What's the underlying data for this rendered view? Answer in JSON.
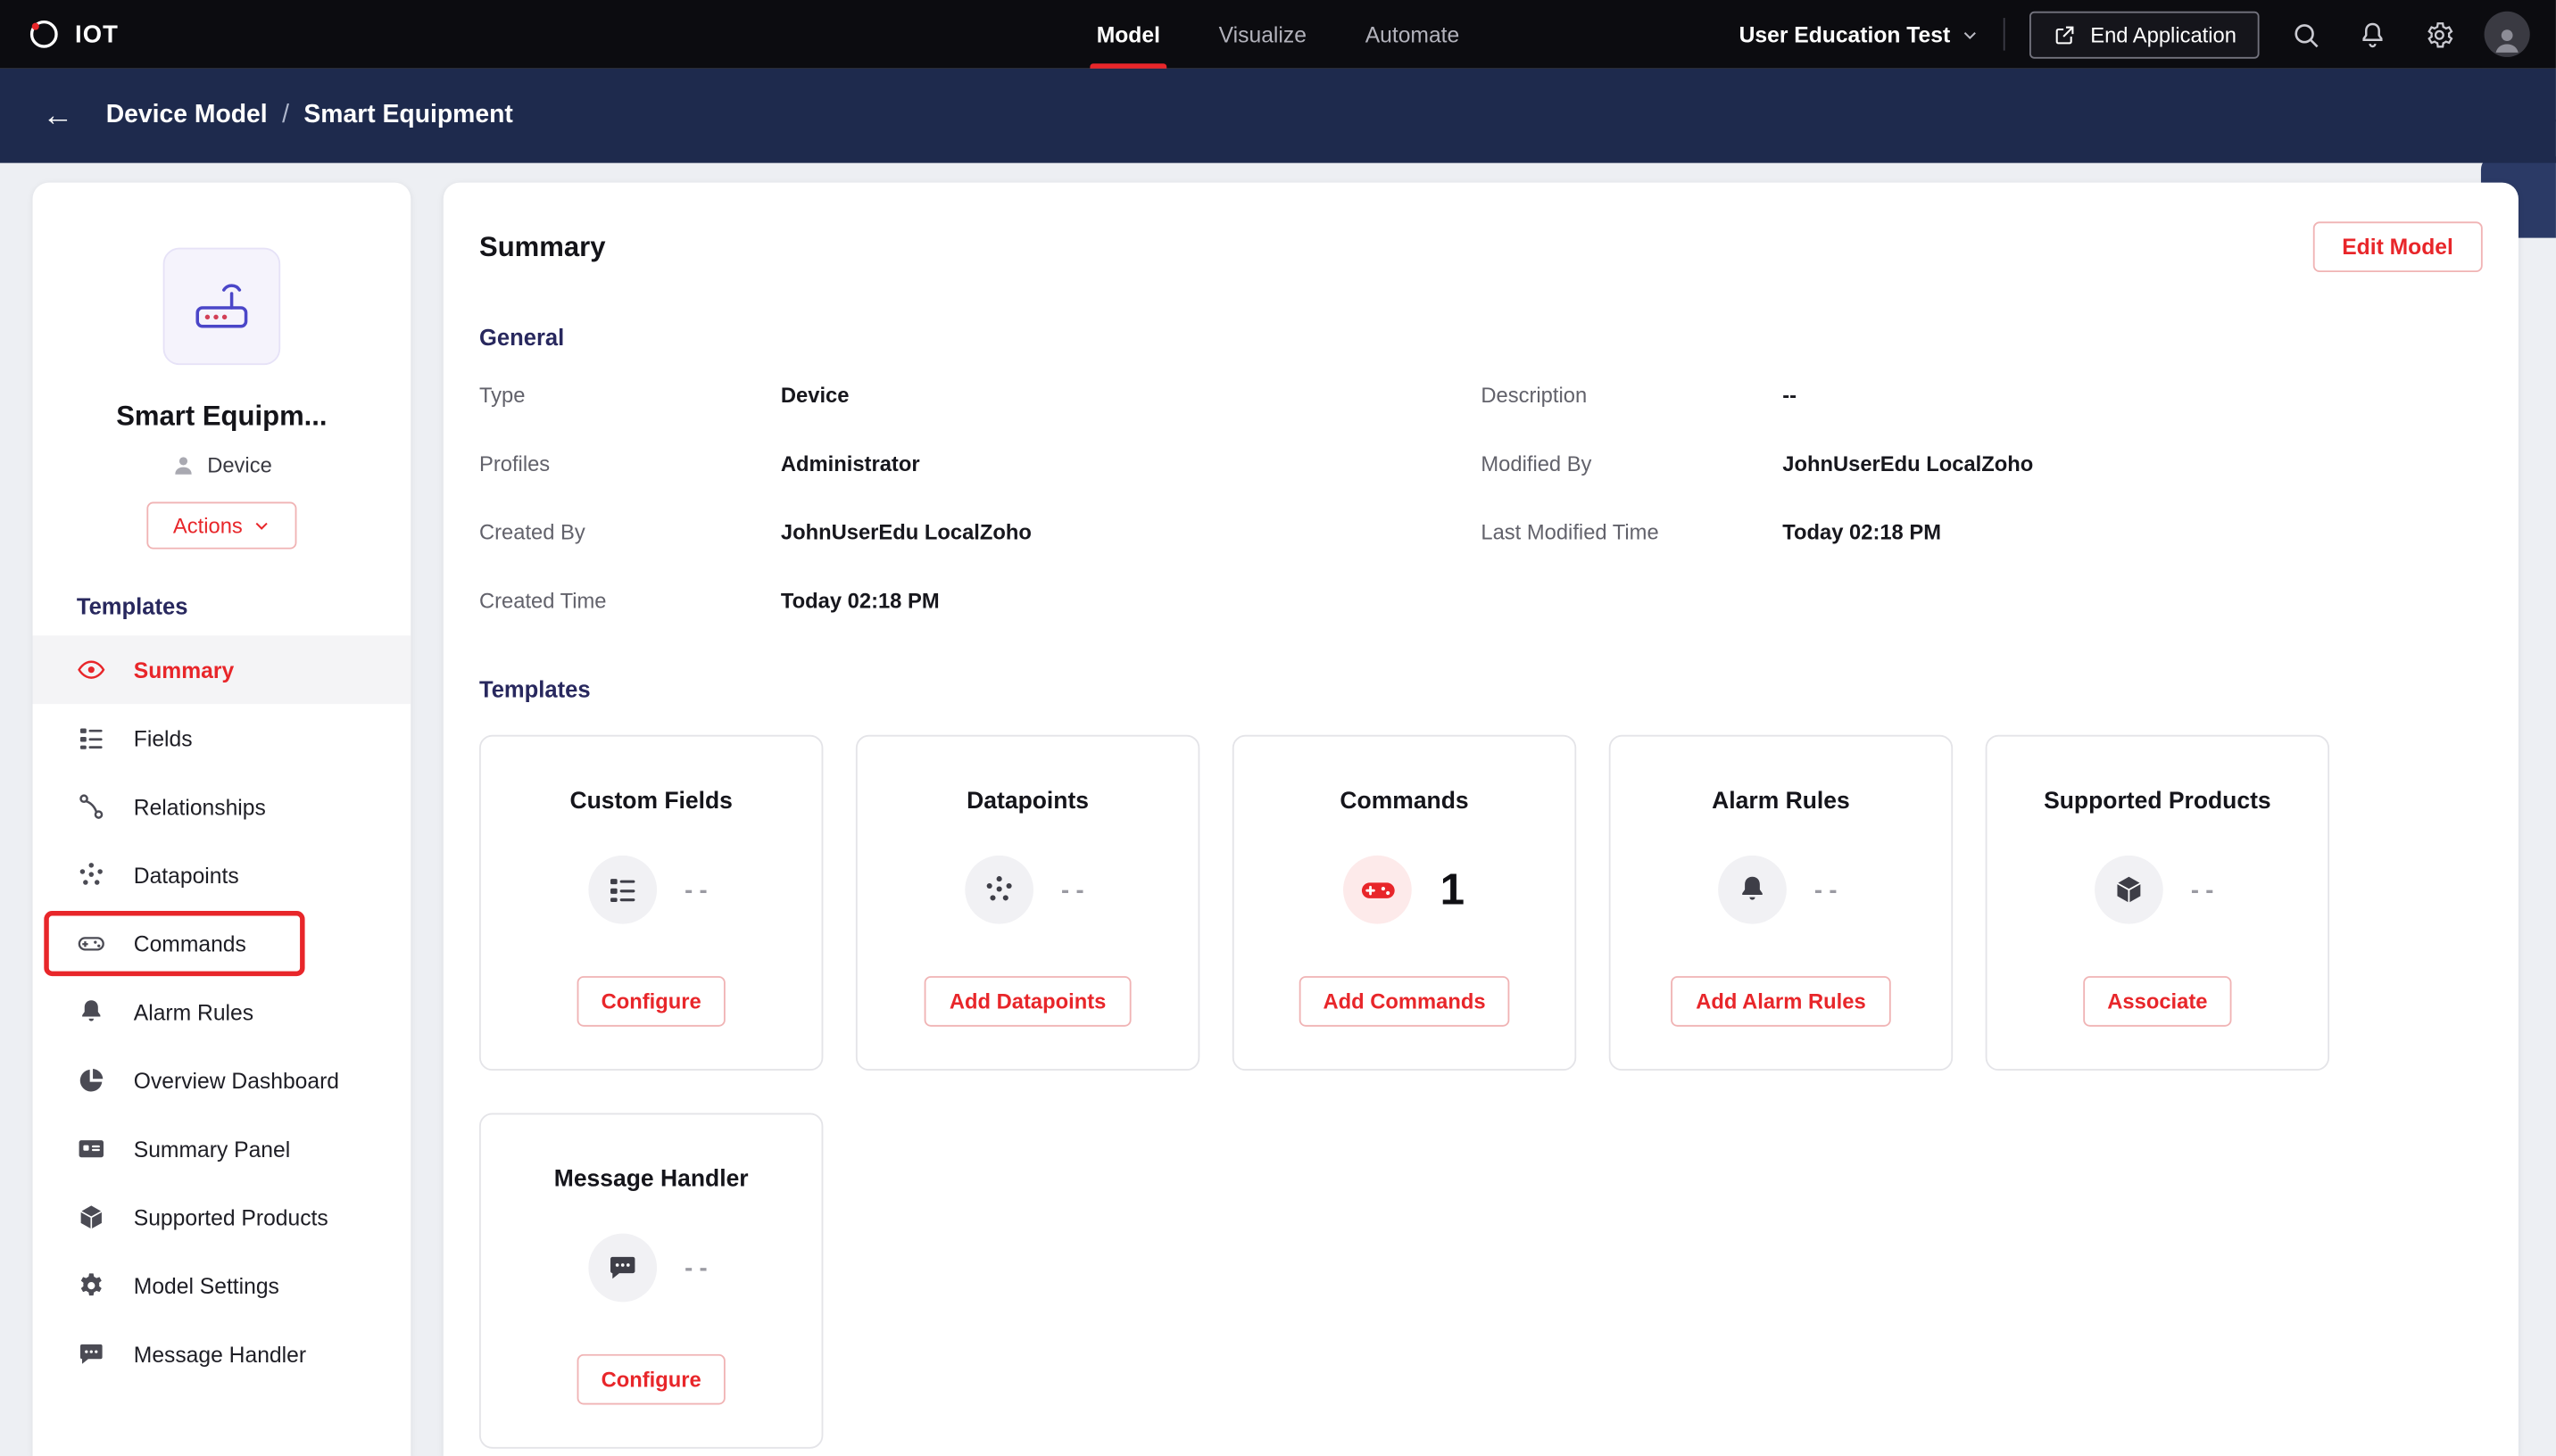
{
  "topbar": {
    "logo_text": "IOT",
    "tabs": [
      {
        "label": "Model",
        "active": true
      },
      {
        "label": "Visualize",
        "active": false
      },
      {
        "label": "Automate",
        "active": false
      }
    ],
    "org_selector": "User Education Test",
    "end_application_label": "End Application"
  },
  "breadcrumb": {
    "parent": "Device Model",
    "separator": "/",
    "current": "Smart Equipment",
    "back_arrow": "←"
  },
  "sidebar": {
    "device_name": "Smart Equipm...",
    "device_type": "Device",
    "actions_label": "Actions",
    "templates_label": "Templates",
    "items": [
      {
        "label": "Summary",
        "active": true
      },
      {
        "label": "Fields"
      },
      {
        "label": "Relationships"
      },
      {
        "label": "Datapoints"
      },
      {
        "label": "Commands",
        "annotated": true
      },
      {
        "label": "Alarm Rules"
      },
      {
        "label": "Overview Dashboard"
      },
      {
        "label": "Summary Panel"
      },
      {
        "label": "Supported Products"
      },
      {
        "label": "Model Settings"
      },
      {
        "label": "Message Handler"
      }
    ]
  },
  "main": {
    "title": "Summary",
    "edit_button": "Edit Model",
    "general": {
      "heading": "General",
      "left": [
        {
          "label": "Type",
          "value": "Device"
        },
        {
          "label": "Profiles",
          "value": "Administrator"
        },
        {
          "label": "Created By",
          "value": "JohnUserEdu LocalZoho"
        },
        {
          "label": "Created Time",
          "value": "Today 02:18 PM"
        }
      ],
      "right": [
        {
          "label": "Description",
          "value": "--"
        },
        {
          "label": "Modified By",
          "value": "JohnUserEdu LocalZoho"
        },
        {
          "label": "Last Modified Time",
          "value": "Today 02:18 PM"
        }
      ]
    },
    "templates": {
      "heading": "Templates",
      "cards": [
        {
          "title": "Custom Fields",
          "value": "--",
          "button": "Configure",
          "icon": "fields-icon"
        },
        {
          "title": "Datapoints",
          "value": "--",
          "button": "Add Datapoints",
          "icon": "datapoints-icon"
        },
        {
          "title": "Commands",
          "value": "1",
          "button": "Add Commands",
          "icon": "commands-icon"
        },
        {
          "title": "Alarm Rules",
          "value": "--",
          "button": "Add Alarm Rules",
          "icon": "alarm-icon"
        },
        {
          "title": "Supported Products",
          "value": "--",
          "button": "Associate",
          "icon": "products-icon"
        },
        {
          "title": "Message Handler",
          "value": "--",
          "button": "Configure",
          "icon": "message-icon"
        }
      ]
    }
  },
  "icons": {
    "search": "magnifier",
    "notifications": "bell",
    "settings": "gear",
    "user": "avatar-circle",
    "end_application": "external-link-arrow",
    "chevron_down": "caret"
  },
  "colors": {
    "accent_red": "#e8262a",
    "navy_header": "#1e2a4d",
    "heading_blue": "#28285e",
    "topbar_black": "#0c0c10",
    "page_bg": "#edeff3"
  }
}
